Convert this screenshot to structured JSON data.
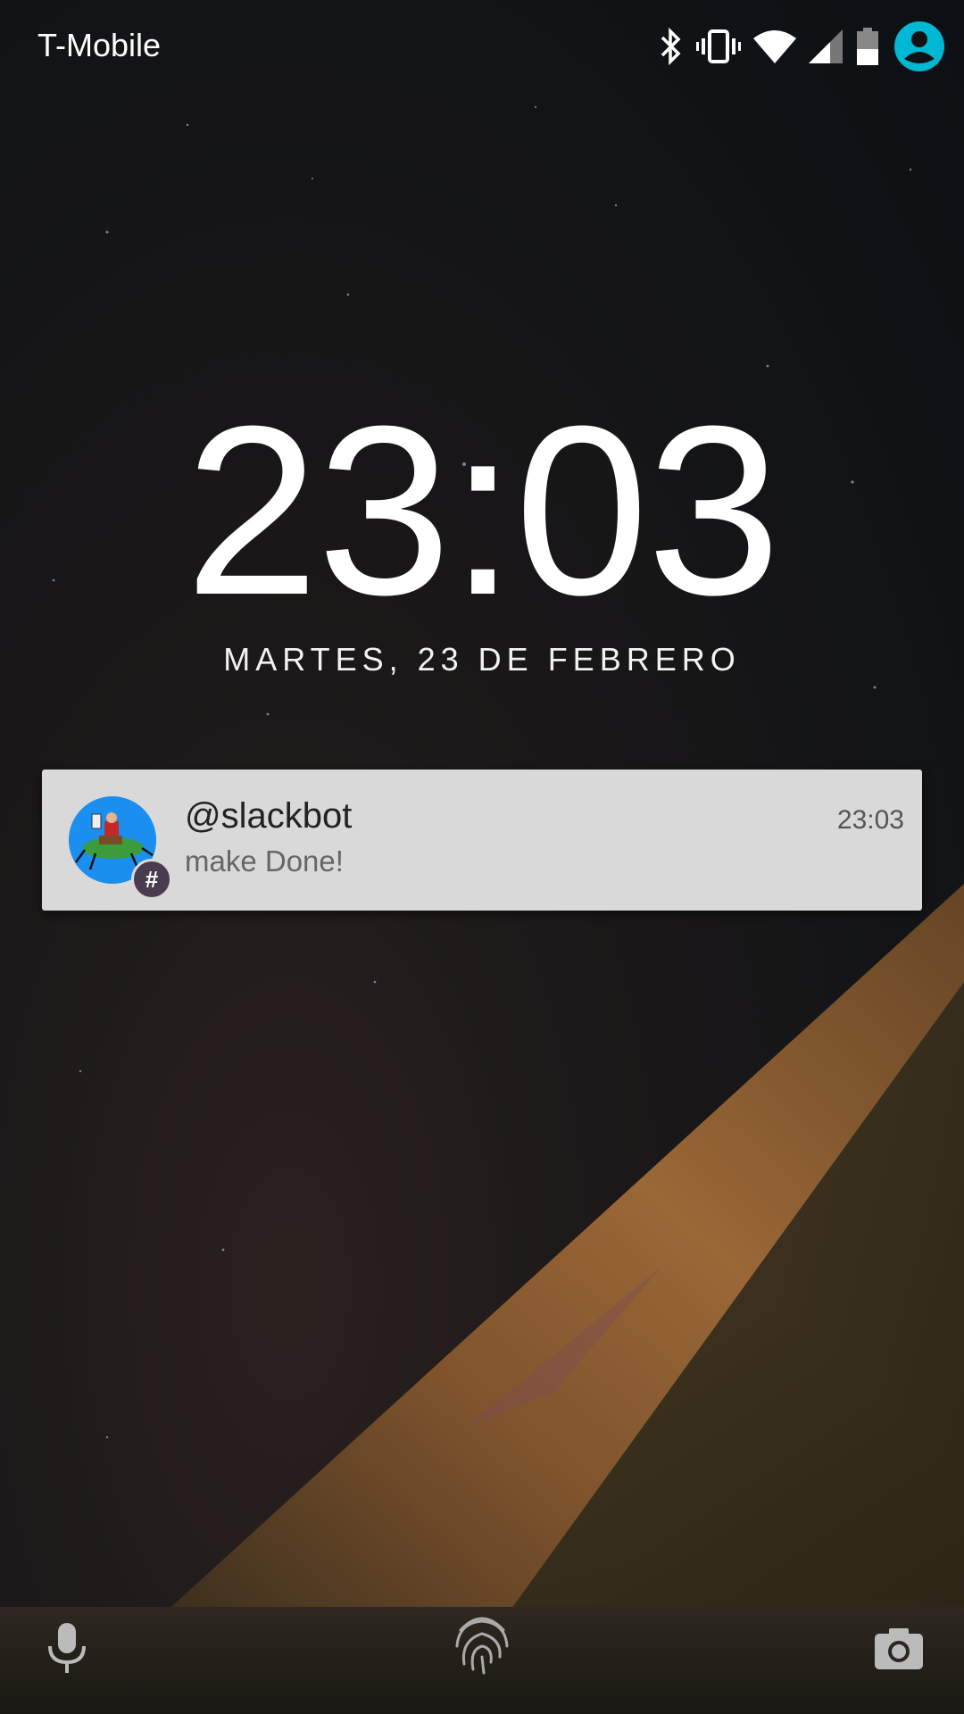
{
  "status_bar": {
    "carrier": "T-Mobile",
    "icons": [
      "bluetooth-icon",
      "vibrate-icon",
      "wifi-icon",
      "signal-icon",
      "battery-icon",
      "user-icon"
    ],
    "accent": "#00b7d4"
  },
  "lock_screen": {
    "time": "23:03",
    "date": "MARTES, 23 DE FEBRERO"
  },
  "notification": {
    "title": "@slackbot",
    "body": "make Done!",
    "time": "23:03",
    "badge_glyph": "#"
  },
  "bottom_bar": {
    "icons": [
      "microphone-icon",
      "fingerprint-icon",
      "camera-icon"
    ]
  }
}
